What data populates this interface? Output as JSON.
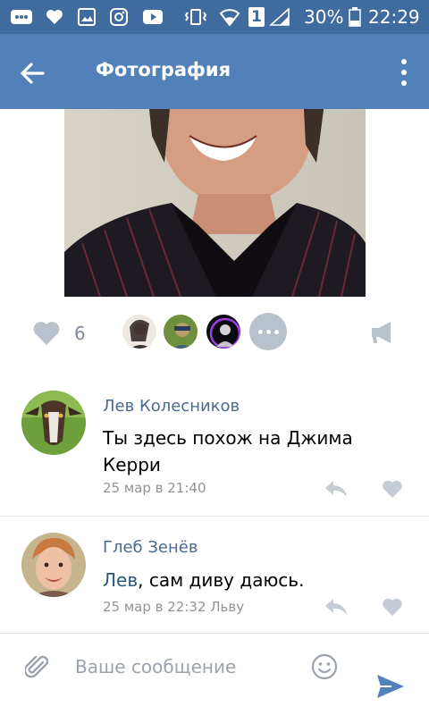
{
  "status_bar": {
    "battery_percent": "30%",
    "time": "22:29",
    "sim_slot": "1"
  },
  "app_bar": {
    "title": "Фотография"
  },
  "post": {
    "likes_count": "6"
  },
  "comments": [
    {
      "author": "Лев Колесников",
      "text": "Ты здесь похож на Джима Керри",
      "time": "25 мар в 21:40"
    },
    {
      "author": "Глеб Зенёв",
      "mention": "Лев",
      "text": ", сам диву даюсь.",
      "time": "25 мар в 22:32 Льву"
    }
  ],
  "composer": {
    "placeholder": "Ваше сообщение"
  },
  "colors": {
    "status_bar": "#3f6b9f",
    "app_bar": "#5181b8",
    "author_link": "#4b6a91",
    "icon_gray": "#b8c1cc",
    "send_blue": "#5181b8"
  }
}
